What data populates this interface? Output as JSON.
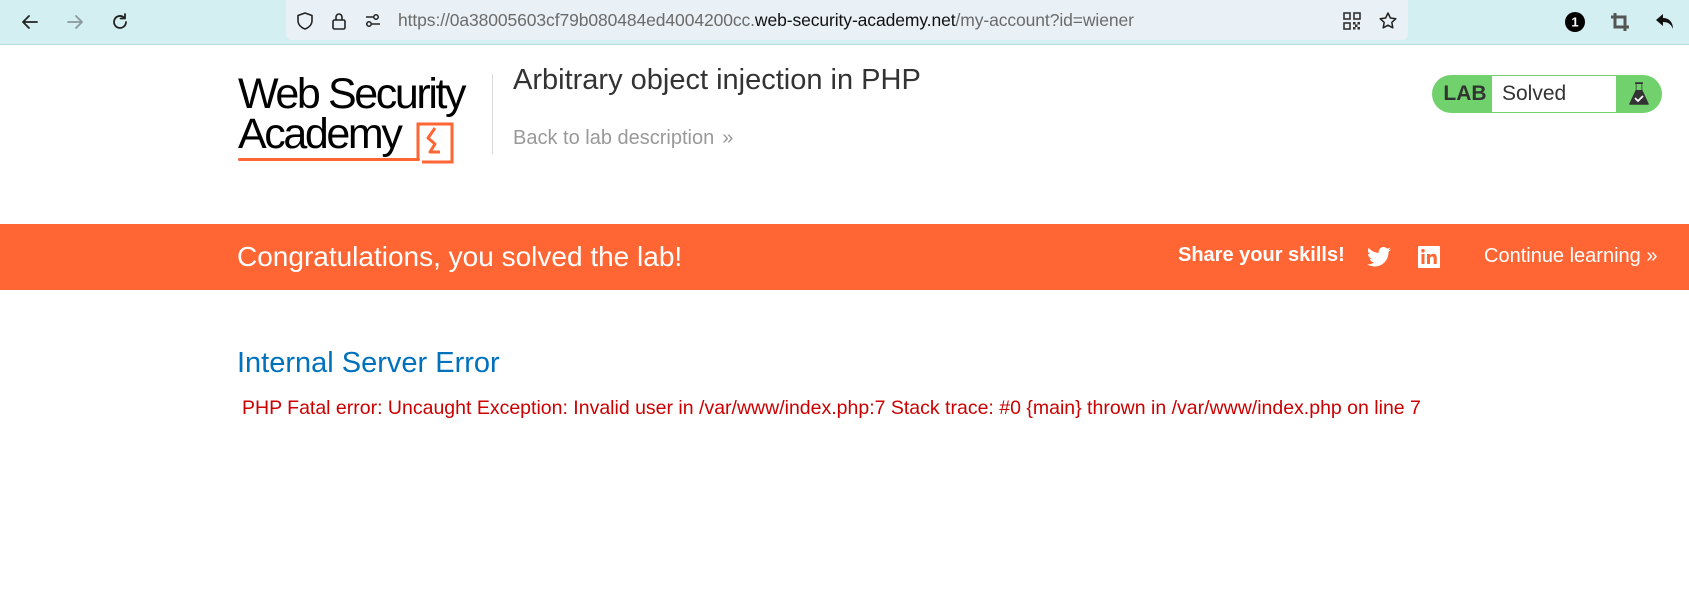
{
  "browser": {
    "url_prefix": "https://0a38005603cf79b080484ed4004200cc.",
    "url_host": "web-security-academy.net",
    "url_path": "/my-account?id=wiener",
    "extension_badge": "1",
    "icons": [
      "back-icon",
      "forward-icon",
      "reload-icon",
      "shield-icon",
      "lock-icon",
      "permissions-icon",
      "qr-code-icon",
      "bookmark-star-icon",
      "extension-badge-icon",
      "crop-icon",
      "undo-icon"
    ]
  },
  "header": {
    "logo_line1": "Web Security",
    "logo_line2": "Academy",
    "lab_title": "Arbitrary object injection in PHP",
    "back_link": "Back to lab description",
    "back_chevron": "»"
  },
  "lab_status": {
    "label": "LAB",
    "value": "Solved"
  },
  "banner": {
    "message": "Congratulations, you solved the lab!",
    "share_label": "Share your skills!",
    "continue_label": "Continue learning",
    "continue_chevron": "»"
  },
  "error": {
    "title": "Internal Server Error",
    "message": "PHP Fatal error: Uncaught Exception: Invalid user in /var/www/index.php:7 Stack trace: #0 {main} thrown in /var/www/index.php on line 7"
  },
  "colors": {
    "brand_orange": "#ff6633",
    "lab_green": "#70d16d",
    "error_title_blue": "#0071bc",
    "error_red": "#cc0000"
  }
}
